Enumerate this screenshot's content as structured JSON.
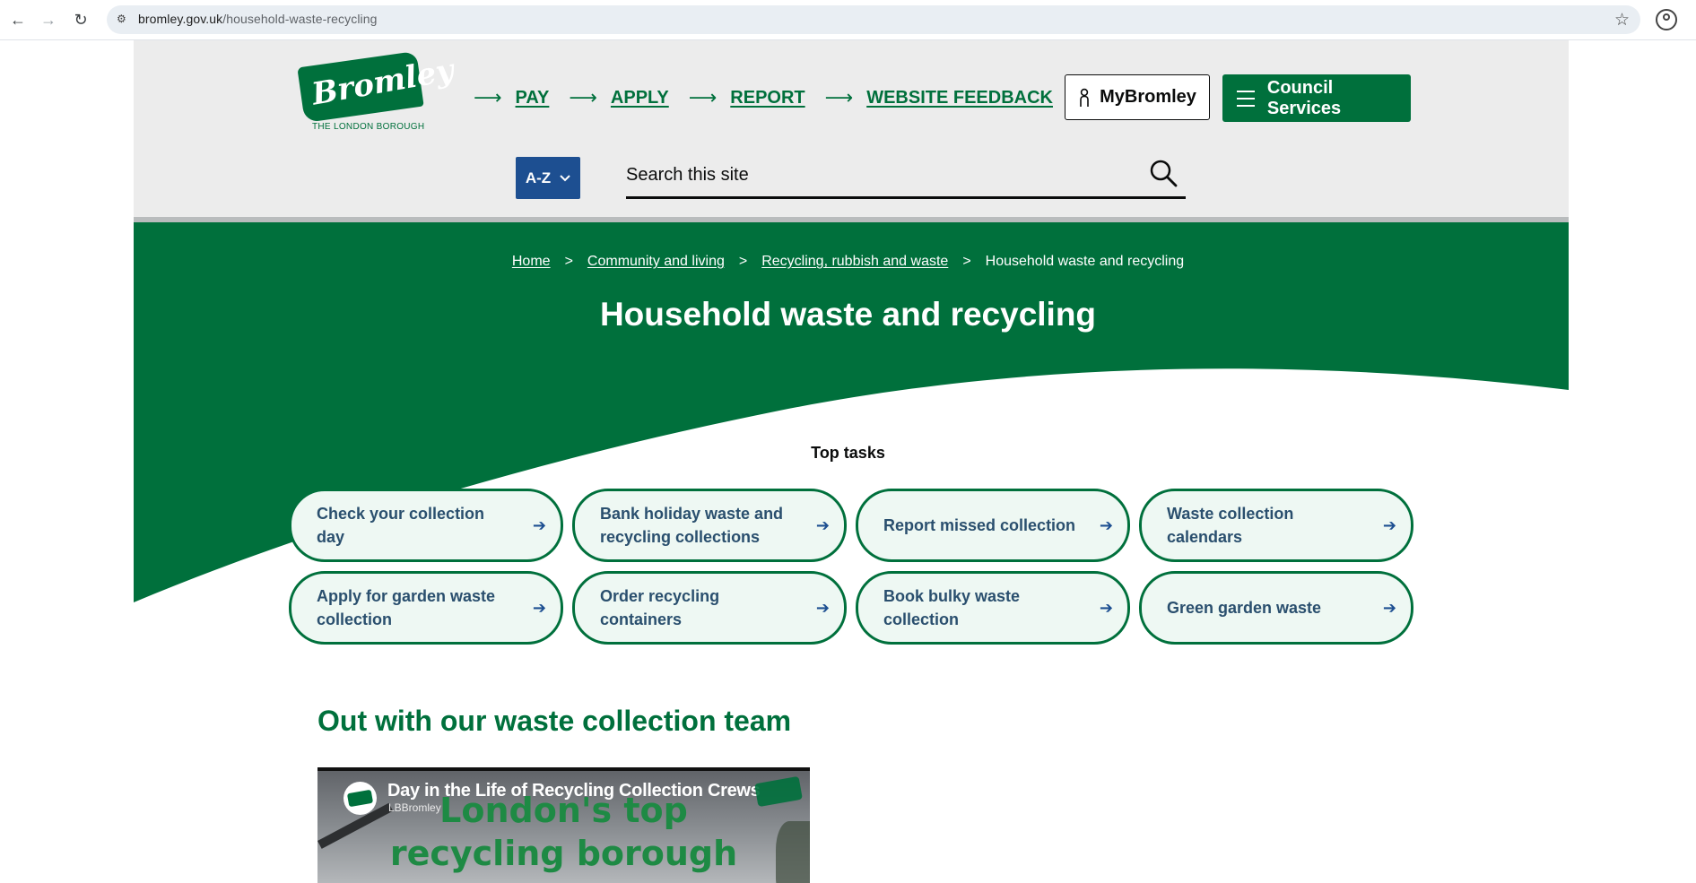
{
  "browser": {
    "url_host": "bromley.gov.uk",
    "url_path": "/household-waste-recycling"
  },
  "header": {
    "logo_text": "Bromley",
    "logo_tagline": "THE LONDON BOROUGH",
    "quick_links": [
      {
        "label": "PAY"
      },
      {
        "label": "APPLY"
      },
      {
        "label": "REPORT"
      },
      {
        "label": "WEBSITE FEEDBACK"
      }
    ],
    "mybromley_label": "MyBromley",
    "council_services_label": "Council Services",
    "az_label": "A-Z",
    "search_placeholder": "Search this site"
  },
  "hero": {
    "breadcrumb": [
      {
        "label": "Home",
        "link": true
      },
      {
        "label": "Community and living",
        "link": true
      },
      {
        "label": "Recycling, rubbish and waste",
        "link": true
      },
      {
        "label": "Household waste and recycling",
        "link": false
      }
    ],
    "breadcrumb_separator": ">",
    "title": "Household waste and recycling"
  },
  "top_tasks": {
    "title": "Top tasks",
    "items": [
      {
        "label": "Check your collection day"
      },
      {
        "label": "Bank holiday waste and recycling collections"
      },
      {
        "label": "Report missed collection"
      },
      {
        "label": "Waste collection calendars"
      },
      {
        "label": "Apply for garden waste collection"
      },
      {
        "label": "Order recycling containers"
      },
      {
        "label": "Book bulky waste collection"
      },
      {
        "label": "Green garden waste"
      }
    ]
  },
  "section": {
    "title": "Out with our waste collection team"
  },
  "video": {
    "title": "Day in the Life of Recycling Collection Crews",
    "channel": "LBBromley",
    "overlay_line1": "London's top",
    "overlay_line2": "recycling borough"
  },
  "colors": {
    "brand_green": "#00703c",
    "az_blue": "#1d4f91",
    "task_bg": "#eef8f3",
    "task_text": "#2a4f6e",
    "header_bg": "#ececec"
  }
}
